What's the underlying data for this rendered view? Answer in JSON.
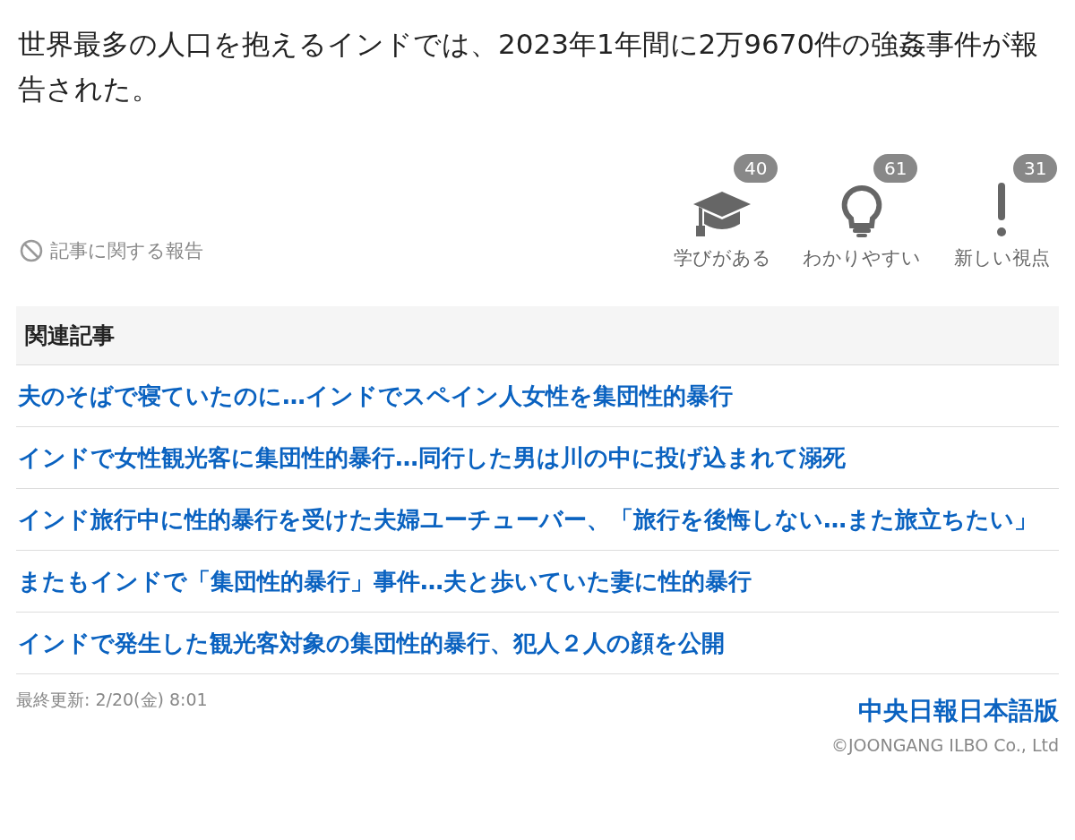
{
  "article": {
    "text": "世界最多の人口を抱えるインドでは、2023年1年間に2万9670件の強姦事件が報告された。"
  },
  "report_link": "記事に関する報告",
  "reactions": [
    {
      "kind": "learn",
      "label": "学びがある",
      "count": "40"
    },
    {
      "kind": "clear",
      "label": "わかりやすい",
      "count": "61"
    },
    {
      "kind": "new",
      "label": "新しい視点",
      "count": "31"
    }
  ],
  "related": {
    "title": "関連記事",
    "items": [
      "夫のそばで寝ていたのに…インドでスペイン人女性を集団性的暴行",
      "インドで女性観光客に集団性的暴行…同行した男は川の中に投げ込まれて溺死",
      "インド旅行中に性的暴行を受けた夫婦ユーチューバー、「旅行を後悔しない…また旅立ちたい」",
      "またもインドで「集団性的暴行」事件…夫と歩いていた妻に性的暴行",
      "インドで発生した観光客対象の集団性的暴行、犯人２人の顔を公開"
    ]
  },
  "footer": {
    "updated": "最終更新: 2/20(金) 8:01",
    "source": "中央日報日本語版",
    "copyright": "©JOONGANG ILBO Co., Ltd"
  }
}
